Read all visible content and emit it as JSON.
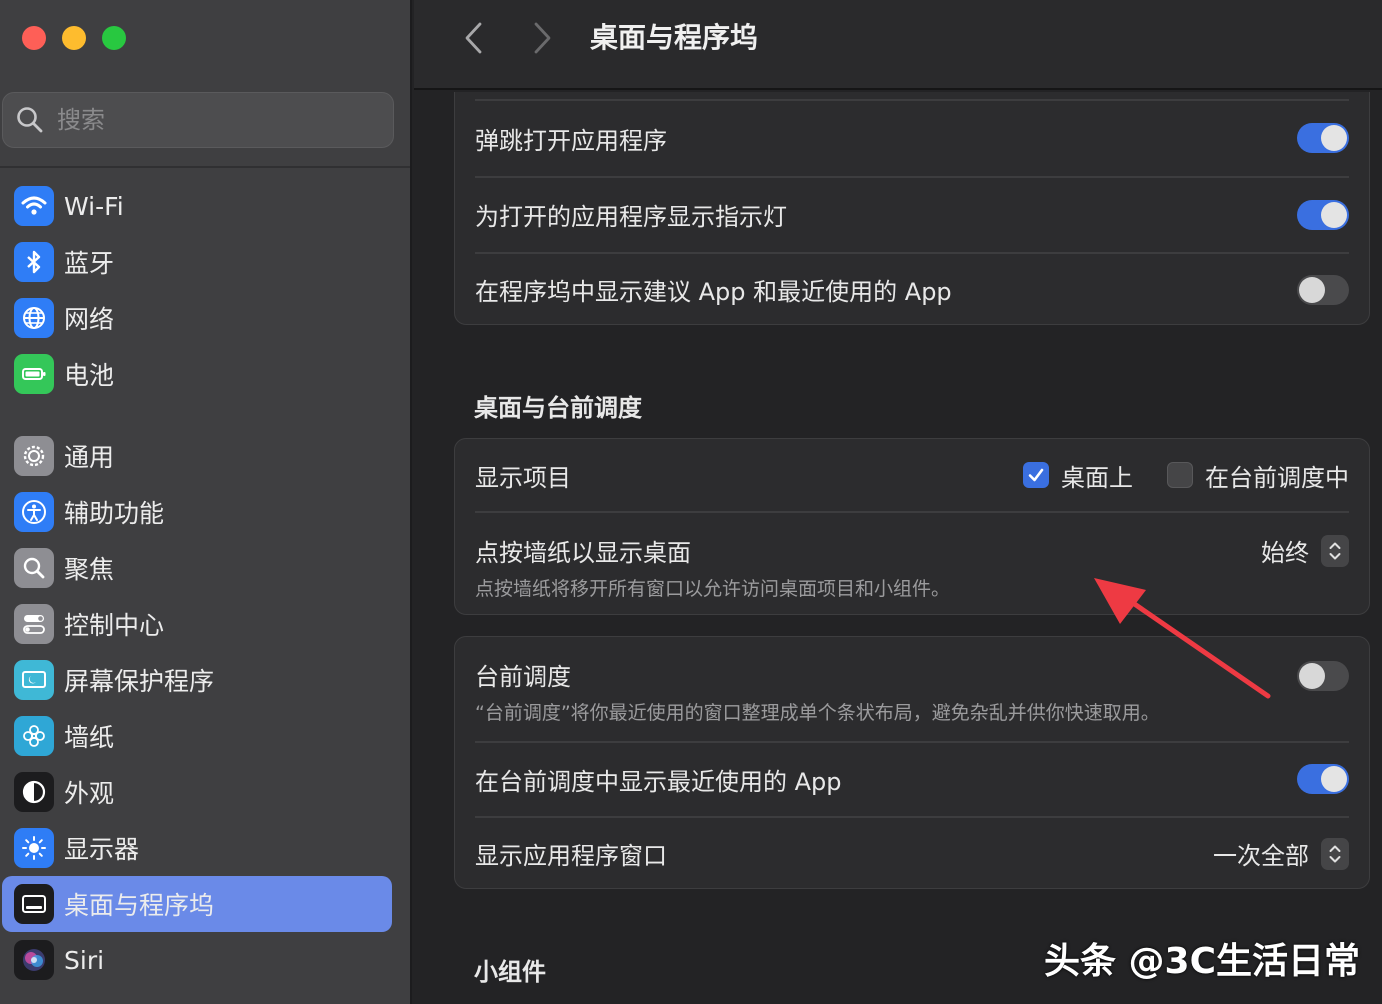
{
  "colors": {
    "accent": "#3a6fe0",
    "sidebar_active": "#6a8ae8",
    "arrow": "#ee3a43"
  },
  "search": {
    "placeholder": "搜索"
  },
  "sidebar": {
    "items": [
      {
        "label": "Wi-Fi",
        "icon": "wifi-icon",
        "color": "#2f7df6"
      },
      {
        "label": "蓝牙",
        "icon": "bluetooth-icon",
        "color": "#2f7df6"
      },
      {
        "label": "网络",
        "icon": "globe-icon",
        "color": "#2f7df6"
      },
      {
        "label": "电池",
        "icon": "battery-icon",
        "color": "#34c759"
      },
      {
        "label": "通用",
        "icon": "gear-icon",
        "color": "#8e8e93"
      },
      {
        "label": "辅助功能",
        "icon": "accessibility-icon",
        "color": "#2f7df6"
      },
      {
        "label": "聚焦",
        "icon": "spotlight-icon",
        "color": "#8e8e93"
      },
      {
        "label": "控制中心",
        "icon": "control-center-icon",
        "color": "#8e8e93"
      },
      {
        "label": "屏幕保护程序",
        "icon": "screensaver-icon",
        "color": "#3fb8d6"
      },
      {
        "label": "墙纸",
        "icon": "wallpaper-icon",
        "color": "#2fa7d6"
      },
      {
        "label": "外观",
        "icon": "appearance-icon",
        "color": "#1c1c1e"
      },
      {
        "label": "显示器",
        "icon": "display-icon",
        "color": "#2f7df6"
      },
      {
        "label": "桌面与程序坞",
        "icon": "dock-icon",
        "color": "#1c1c1e",
        "active": true
      },
      {
        "label": "Siri",
        "icon": "siri-icon",
        "color": "#1c1c1e"
      }
    ]
  },
  "header": {
    "title": "桌面与程序坞"
  },
  "dock_card": {
    "rows": [
      {
        "label": "弹跳打开应用程序",
        "on": true
      },
      {
        "label": "为打开的应用程序显示指示灯",
        "on": true
      },
      {
        "label": "在程序坞中显示建议 App 和最近使用的 App",
        "on": false
      }
    ]
  },
  "desktop_section": {
    "title": "桌面与台前调度",
    "show_items": {
      "label": "显示项目",
      "options": [
        {
          "label": "桌面上",
          "checked": true
        },
        {
          "label": "在台前调度中",
          "checked": false
        }
      ]
    },
    "click_wallpaper": {
      "label": "点按墙纸以显示桌面",
      "desc": "点按墙纸将移开所有窗口以允许访问桌面项目和小组件。",
      "value": "始终"
    }
  },
  "stage_card": {
    "stage_manager": {
      "label": "台前调度",
      "desc": "“台前调度”将你最近使用的窗口整理成单个条状布局，避免杂乱并供你快速取用。",
      "on": false
    },
    "recent_apps": {
      "label": "在台前调度中显示最近使用的 App",
      "on": true
    },
    "app_windows": {
      "label": "显示应用程序窗口",
      "value": "一次全部"
    }
  },
  "widgets_section": {
    "title": "小组件"
  },
  "watermark": "头条 @3C生活日常"
}
